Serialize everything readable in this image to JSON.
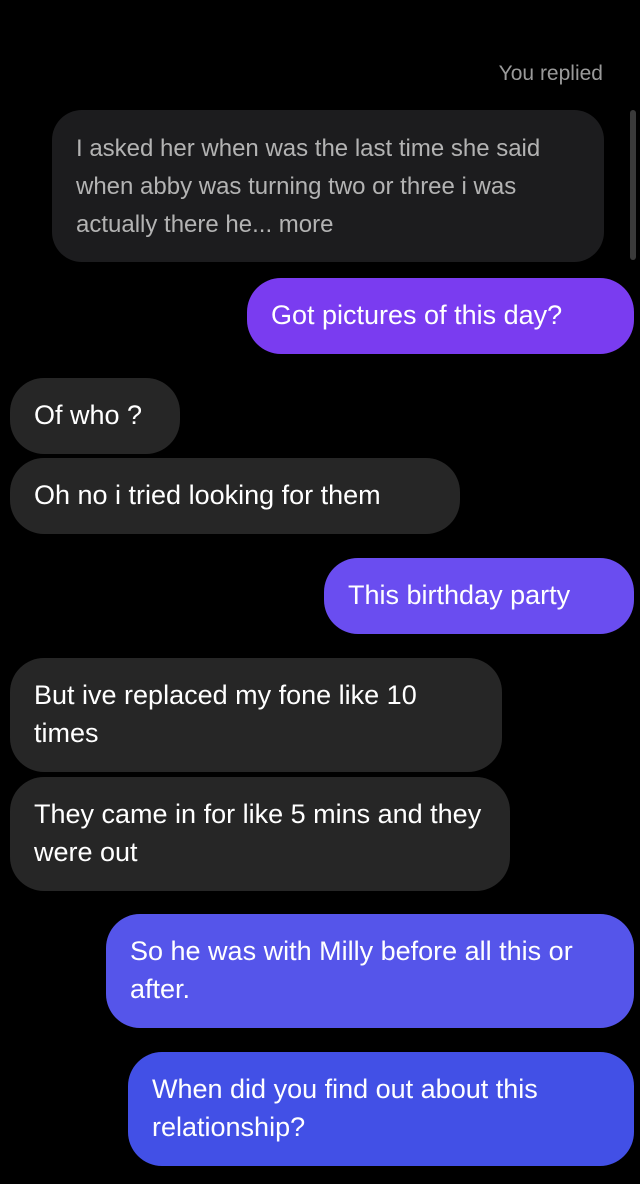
{
  "thread": {
    "replied_label": "You replied",
    "quoted_message": "I asked her when was the last time she said when abby was turning two or three i was actually there he... more",
    "messages": [
      {
        "sender": "me",
        "text": "Got pictures of this day?"
      },
      {
        "sender": "them",
        "text": "Of who ?"
      },
      {
        "sender": "them",
        "text": "Oh no i tried looking for them"
      },
      {
        "sender": "me",
        "text": "This birthday party"
      },
      {
        "sender": "them",
        "text": "But ive replaced my fone like 10 times"
      },
      {
        "sender": "them",
        "text": "They came in for like 5 mins and they were out"
      },
      {
        "sender": "me",
        "text": "So he was with Milly before all this or after."
      },
      {
        "sender": "me",
        "text": "When did you find out about this relationship?"
      }
    ]
  },
  "colors": {
    "background": "#000000",
    "incoming_bubble": "#262626",
    "quoted_bubble": "#1c1c1e",
    "outgoing_purple": "#7a3cf0",
    "outgoing_blue": "#4a4fe6"
  }
}
